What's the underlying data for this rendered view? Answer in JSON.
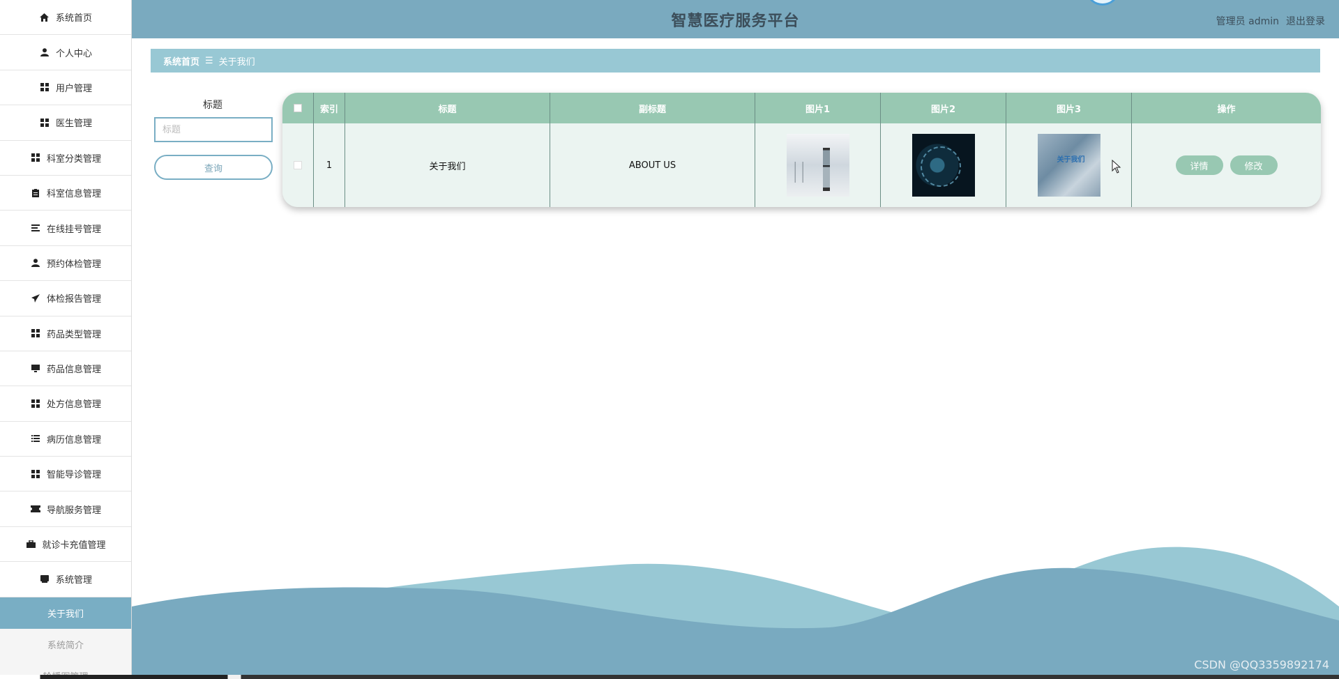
{
  "header": {
    "title": "智慧医疗服务平台",
    "user": "管理员 admin",
    "logout": "退出登录"
  },
  "sidebar": {
    "items": [
      {
        "label": "系统首页",
        "icon": "home-icon"
      },
      {
        "label": "个人中心",
        "icon": "user-icon"
      },
      {
        "label": "用户管理",
        "icon": "grid-icon"
      },
      {
        "label": "医生管理",
        "icon": "grid-icon"
      },
      {
        "label": "科室分类管理",
        "icon": "grid-icon"
      },
      {
        "label": "科室信息管理",
        "icon": "clipboard-icon"
      },
      {
        "label": "在线挂号管理",
        "icon": "list-icon"
      },
      {
        "label": "预约体检管理",
        "icon": "user-icon"
      },
      {
        "label": "体检报告管理",
        "icon": "send-icon"
      },
      {
        "label": "药品类型管理",
        "icon": "grid-icon"
      },
      {
        "label": "药品信息管理",
        "icon": "monitor-icon"
      },
      {
        "label": "处方信息管理",
        "icon": "grid-icon"
      },
      {
        "label": "病历信息管理",
        "icon": "list-icon"
      },
      {
        "label": "智能导诊管理",
        "icon": "grid-icon"
      },
      {
        "label": "导航服务管理",
        "icon": "ticket-icon"
      },
      {
        "label": "就诊卡充值管理",
        "icon": "briefcase-icon"
      },
      {
        "label": "系统管理",
        "icon": "tablet-icon"
      }
    ],
    "sub_items": [
      {
        "label": "关于我们",
        "active": true
      },
      {
        "label": "系统简介",
        "active": false
      },
      {
        "label": "轮播图管理",
        "active": false
      }
    ]
  },
  "breadcrumb": {
    "home": "系统首页",
    "separator": "☰",
    "current": "关于我们"
  },
  "search": {
    "label": "标题",
    "placeholder": "标题",
    "button": "查询"
  },
  "table": {
    "columns": [
      "索引",
      "标题",
      "副标题",
      "图片1",
      "图片2",
      "图片3",
      "操作"
    ],
    "rows": [
      {
        "index": "1",
        "title": "关于我们",
        "subtitle": "ABOUT US",
        "img3_text": "关于我们",
        "detail": "详情",
        "edit": "修改"
      }
    ]
  },
  "watermark": "CSDN @QQ3359892174",
  "colors": {
    "header": "#7aaabf",
    "breadcrumb": "#98c8d4",
    "table_head": "#98c8b2",
    "active_menu": "#79aec4"
  }
}
